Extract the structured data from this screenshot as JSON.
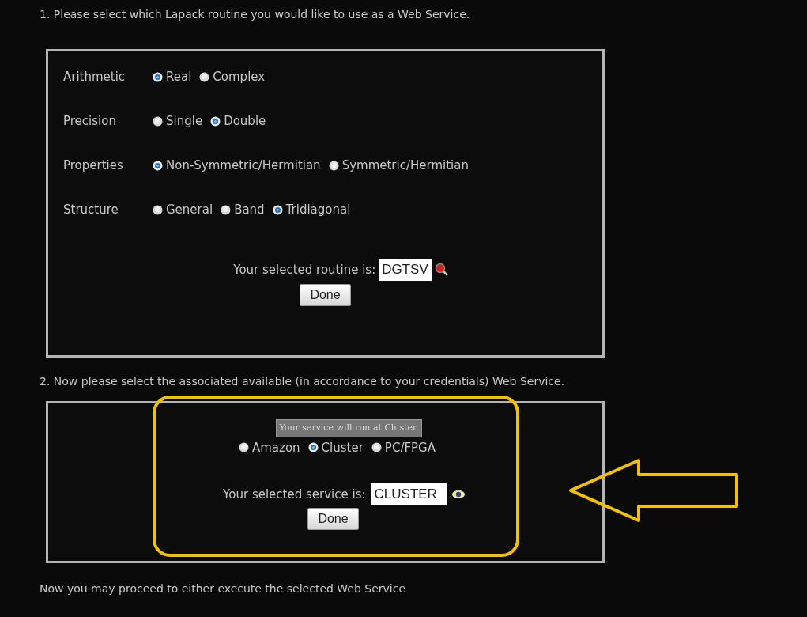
{
  "step1": {
    "instruction": "1. Please select which Lapack routine you would like to use as a Web Service.",
    "groups": [
      {
        "label": "Arithmetic",
        "options": [
          {
            "label": "Real",
            "selected": true
          },
          {
            "label": "Complex",
            "selected": false
          }
        ]
      },
      {
        "label": "Precision",
        "options": [
          {
            "label": "Single",
            "selected": false
          },
          {
            "label": "Double",
            "selected": true
          }
        ]
      },
      {
        "label": "Properties",
        "options": [
          {
            "label": "Non-Symmetric/Hermitian",
            "selected": true
          },
          {
            "label": "Symmetric/Hermitian",
            "selected": false
          }
        ]
      },
      {
        "label": "Structure",
        "options": [
          {
            "label": "General",
            "selected": false
          },
          {
            "label": "Band",
            "selected": false
          },
          {
            "label": "Tridiagonal",
            "selected": true
          }
        ]
      }
    ],
    "result_label": "Your selected routine is:",
    "result_value": "DGTSV",
    "button": "Done"
  },
  "step2": {
    "instruction": "2. Now please select the associated available (in accordance to your credentials) Web Service.",
    "tooltip": "Your service will run at Cluster.",
    "options": [
      {
        "label": "Amazon",
        "selected": false
      },
      {
        "label": "Cluster",
        "selected": true
      },
      {
        "label": "PC/FPGA",
        "selected": false
      }
    ],
    "result_label": "Your selected service is:",
    "result_value": "CLUSTER",
    "button": "Done"
  },
  "footer": "Now you may proceed to either execute the selected Web Service"
}
